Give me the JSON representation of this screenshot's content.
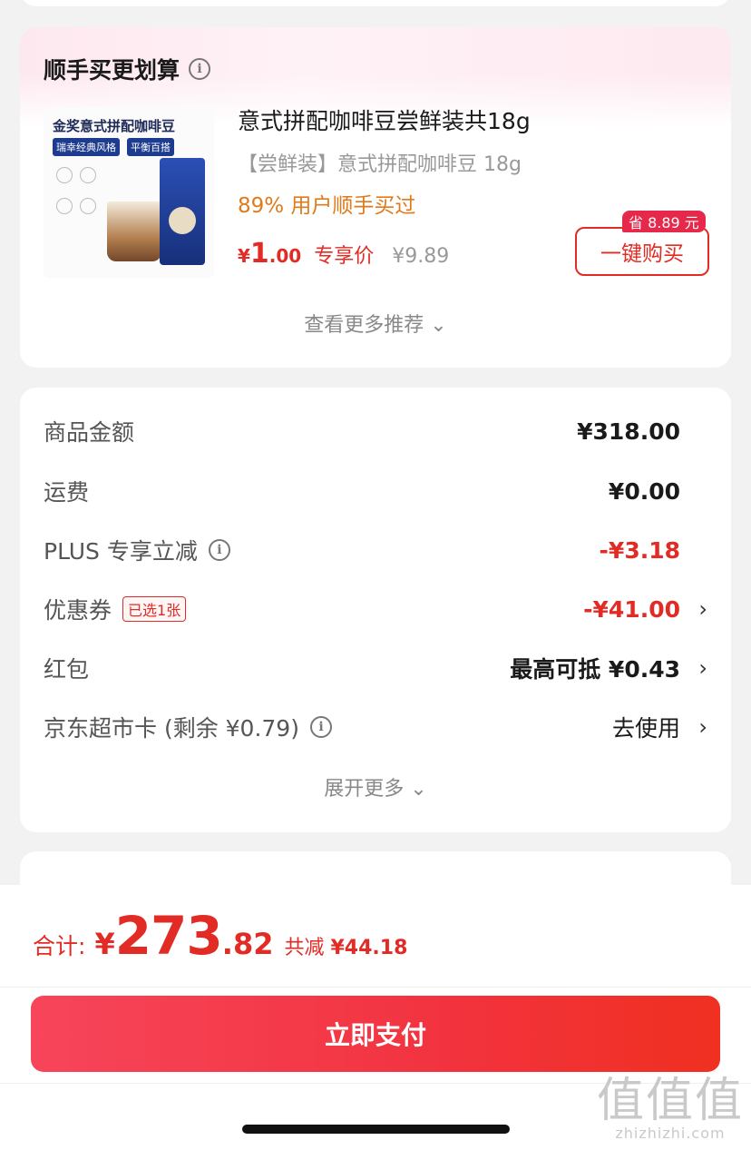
{
  "recommend": {
    "title": "顺手买更划算",
    "product": {
      "image_text": {
        "title": "金奖意式拼配咖啡豆",
        "tag1": "瑞幸经典风格",
        "tag2": "平衡百搭"
      },
      "name": "意式拼配咖啡豆尝鲜装共18g",
      "subtitle": "【尝鲜装】意式拼配咖啡豆 18g",
      "bought": "89% 用户顺手买过",
      "price_currency": "¥",
      "price_int": "1",
      "price_dec": ".00",
      "exclusive_label": "专享价",
      "original_price": "¥9.89",
      "save_badge": "省 8.89 元",
      "buy_button": "一键购买"
    },
    "more": "查看更多推荐 ⌄"
  },
  "details": {
    "goods_amount": {
      "label": "商品金额",
      "value": "¥318.00"
    },
    "shipping": {
      "label": "运费",
      "value": "¥0.00"
    },
    "plus": {
      "label": "PLUS 专享立减",
      "value": "-¥3.18"
    },
    "coupon": {
      "label": "优惠券",
      "tag": "已选1张",
      "value": "-¥41.00"
    },
    "red_packet": {
      "label": "红包",
      "value": "最高可抵 ¥0.43"
    },
    "market_card": {
      "label": "京东超市卡 (剩余 ¥0.79)",
      "value": "去使用"
    },
    "expand": "展开更多 ⌄"
  },
  "footer": {
    "total_label": "合计:",
    "total_currency": "¥",
    "total_int": "273",
    "total_dec": ".82",
    "reduce_label": "共减",
    "reduce_value": "¥44.18",
    "pay_button": "立即支付"
  },
  "watermark": {
    "logo": "值值值",
    "site": "zhizhizhi.com"
  },
  "colors": {
    "accent": "#e22b24",
    "bought": "#e07a1a",
    "badge": "#e6284a"
  }
}
